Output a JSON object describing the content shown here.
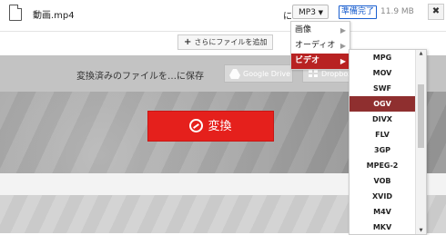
{
  "file": {
    "name": "動画.mp4",
    "to_label": "に",
    "format": "MP3",
    "status": "準備完了",
    "size": "11.9 MB",
    "close_label": "✖"
  },
  "add_more": {
    "label": "さらにファイルを追加",
    "icon": "+"
  },
  "save": {
    "label": "変換済みのファイルを…に保存",
    "services": [
      {
        "name": "Google Drive",
        "icon": "google-drive-icon"
      },
      {
        "name": "Dropbox",
        "icon": "dropbox-icon"
      }
    ]
  },
  "convert": {
    "label": "変換",
    "icon": "convert-icon"
  },
  "categories": [
    {
      "label": "画像"
    },
    {
      "label": "オーディオ"
    },
    {
      "label": "ビデオ",
      "selected": true
    }
  ],
  "video_formats": [
    {
      "label": "MPG"
    },
    {
      "label": "MOV"
    },
    {
      "label": "SWF"
    },
    {
      "label": "OGV",
      "selected": true
    },
    {
      "label": "DIVX"
    },
    {
      "label": "FLV"
    },
    {
      "label": "3GP"
    },
    {
      "label": "MPEG-2"
    },
    {
      "label": "VOB"
    },
    {
      "label": "XVID"
    },
    {
      "label": "M4V"
    },
    {
      "label": "MKV"
    }
  ],
  "colors": {
    "convert": "#e5201c",
    "selected_category": "#b82222",
    "selected_format": "#8f2f2f",
    "status": "#1a5fcf"
  }
}
